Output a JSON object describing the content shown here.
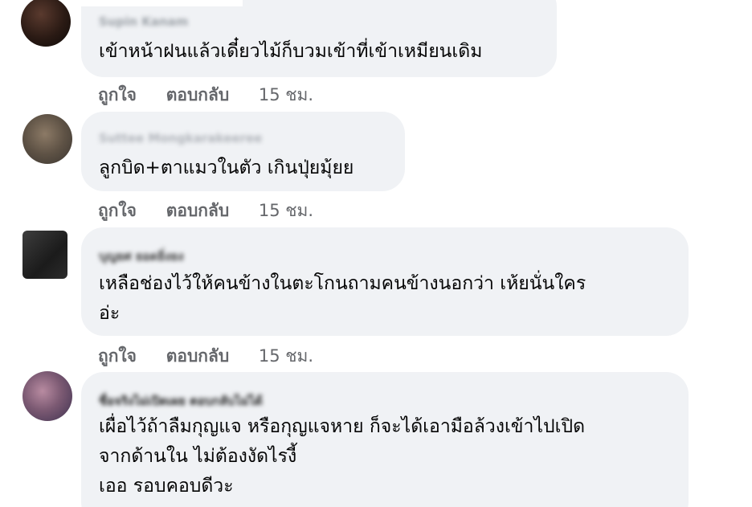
{
  "comments": [
    {
      "author": "Supin Kanam",
      "text": "เข้าหน้าฝนแล้วเดี๋ยวไม้ก็บวมเข้าที่เข้าเหมียนเดิม",
      "like_label": "ถูกใจ",
      "reply_label": "ตอบกลับ",
      "time": "15 ชม."
    },
    {
      "author": "Suttee Mongkarakeeree",
      "text": "ลูกบิด+ตาแมวในตัว เกินปุ่ยมุ้ยย",
      "like_label": "ถูกใจ",
      "reply_label": "ตอบกลับ",
      "time": "15 ชม."
    },
    {
      "author": "บุญยศ ยอดยิ่งยง",
      "text": "เหลือช่องไว้ให้คนข้างในตะโกนถามคนข้างนอกว่า เห้ยนั่นใคร\nอ่ะ",
      "like_label": "ถูกใจ",
      "reply_label": "ตอบกลับ",
      "time": "15 ชม."
    },
    {
      "author": "ชื่อจริงไม่เปิดเผย ตอบกลับไม่ได้",
      "text": "เผื่อไว้ถ้าลืมกุญแจ หรือกุญแจหาย ก็จะได้เอามือล้วงเข้าไปเปิด\nจากด้านใน ไม่ต้องงัดไรงี้\nเออ รอบคอบดีวะ"
    }
  ]
}
